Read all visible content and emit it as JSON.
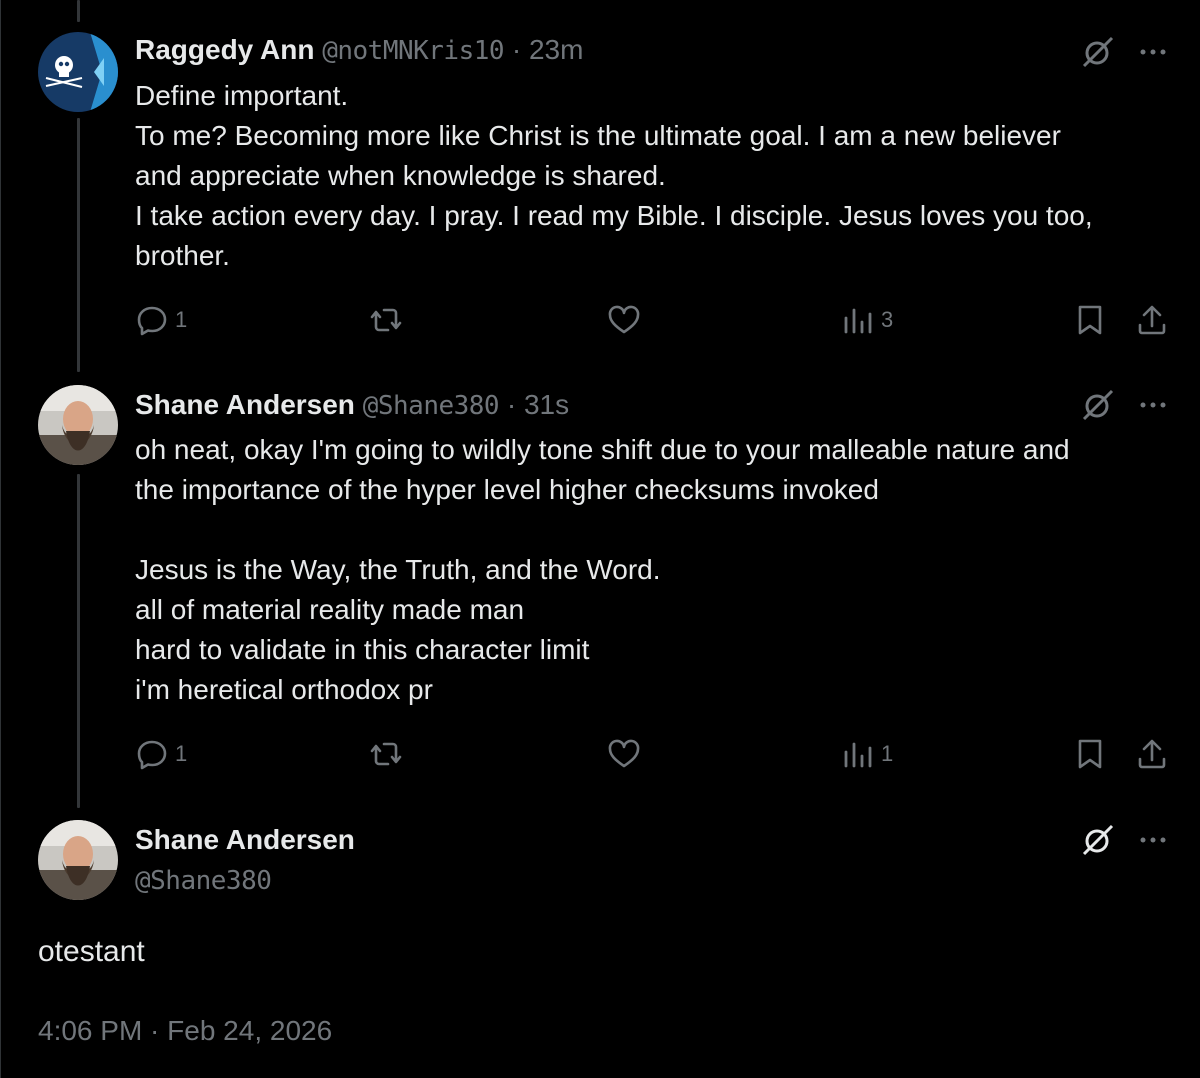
{
  "posts": [
    {
      "name": "Raggedy Ann",
      "handle": "@notMNKris10",
      "separator": "·",
      "time": "23m",
      "lines": [
        "Define important.",
        "To me? Becoming more like Christ is the ultimate goal. I am a new believer",
        "and appreciate when knowledge is shared.",
        "I take action every day. I pray. I read my Bible. I disciple. Jesus loves you too,",
        "brother."
      ],
      "replies": "1",
      "views": "3"
    },
    {
      "name": "Shane Andersen",
      "handle": "@Shane380",
      "separator": "·",
      "time": "31s",
      "lines": [
        "oh neat, okay I'm going to wildly tone shift due to your malleable nature and",
        "the importance of the hyper level higher checksums invoked",
        "",
        "Jesus is the Way, the Truth, and the Word.",
        "all of material reality made man",
        "hard to validate in this character limit",
        "i'm heretical orthodox pr"
      ],
      "replies": "1",
      "views": "1"
    }
  ],
  "main_post": {
    "name": "Shane Andersen",
    "handle": "@Shane380",
    "text": "otestant",
    "timestamp": "4:06 PM · Feb 24, 2026"
  },
  "icons": {
    "reply": "reply-icon",
    "repost": "repost-icon",
    "like": "heart-icon",
    "views": "analytics-icon",
    "bookmark": "bookmark-icon",
    "share": "share-icon",
    "grok": "grok-icon",
    "more": "more-icon"
  },
  "colors": {
    "background": "#000000",
    "text": "#e7e9ea",
    "muted": "#71767b",
    "thread_line": "#333639"
  }
}
